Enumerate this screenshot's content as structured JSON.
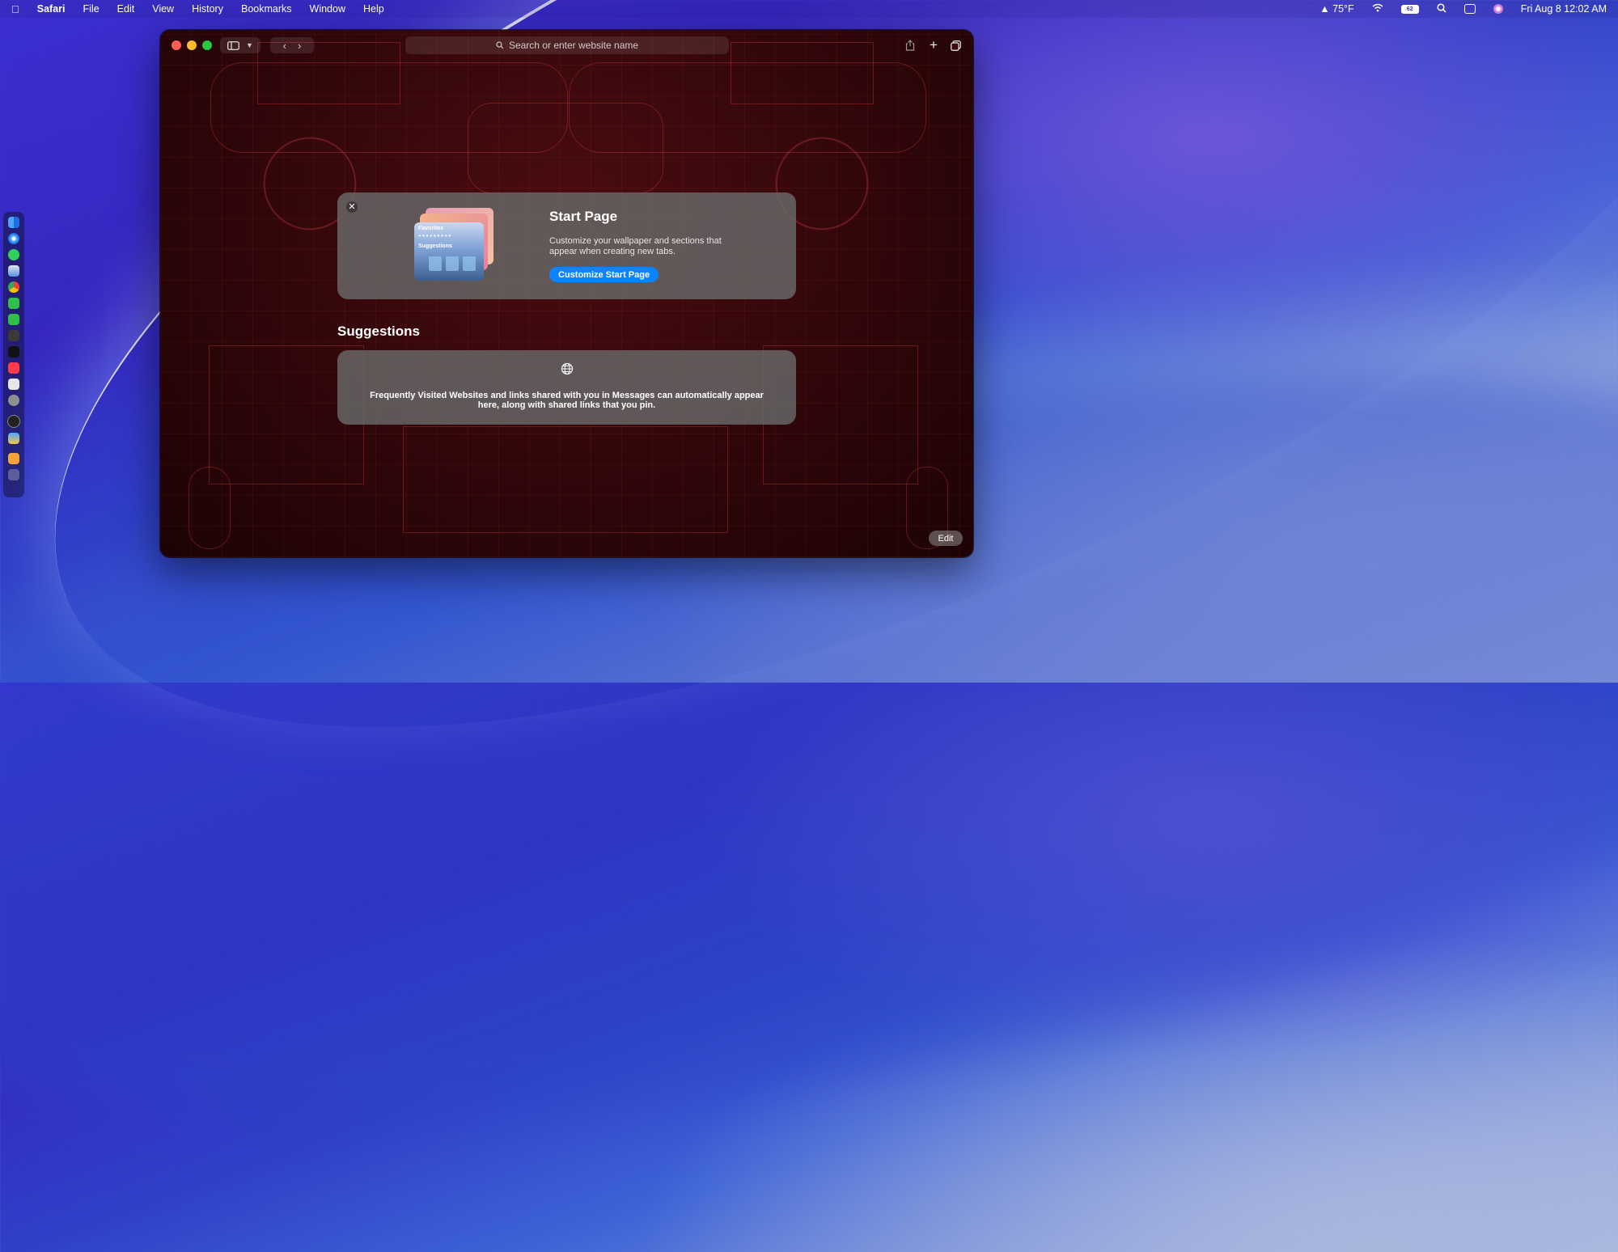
{
  "menubar": {
    "apple_icon": "apple-logo-icon",
    "app_name": "Safari",
    "menus": [
      "File",
      "Edit",
      "View",
      "History",
      "Bookmarks",
      "Window",
      "Help"
    ],
    "weather": "75°F",
    "battery": "62",
    "datetime": "Fri Aug 8  12:02 AM"
  },
  "toolbar": {
    "address_placeholder": "Search or enter website name"
  },
  "start_page_card": {
    "title": "Start Page",
    "description": "Customize your wallpaper and sections that appear when creating new tabs.",
    "button_label": "Customize Start Page",
    "thumb_favorites_label": "Favorites",
    "thumb_suggestions_label": "Suggestions"
  },
  "suggestions": {
    "heading": "Suggestions",
    "message": "Frequently Visited Websites and links shared with you in Messages can automatically appear here, along with shared links that you pin."
  },
  "edit_button_label": "Edit",
  "colors": {
    "accent": "#0a84ff",
    "close": "#ff5f57",
    "minimize": "#febc2e",
    "zoom": "#28c840"
  },
  "dock_apps": [
    "finder-icon",
    "safari-icon",
    "messages-icon",
    "mail-icon",
    "chrome-icon",
    "facetime-icon",
    "phone-icon",
    "keychain-icon",
    "appletv-icon",
    "music-icon",
    "notes-icon",
    "settings-icon",
    "clock-icon",
    "weather-icon",
    "pages-icon",
    "trash-icon"
  ]
}
